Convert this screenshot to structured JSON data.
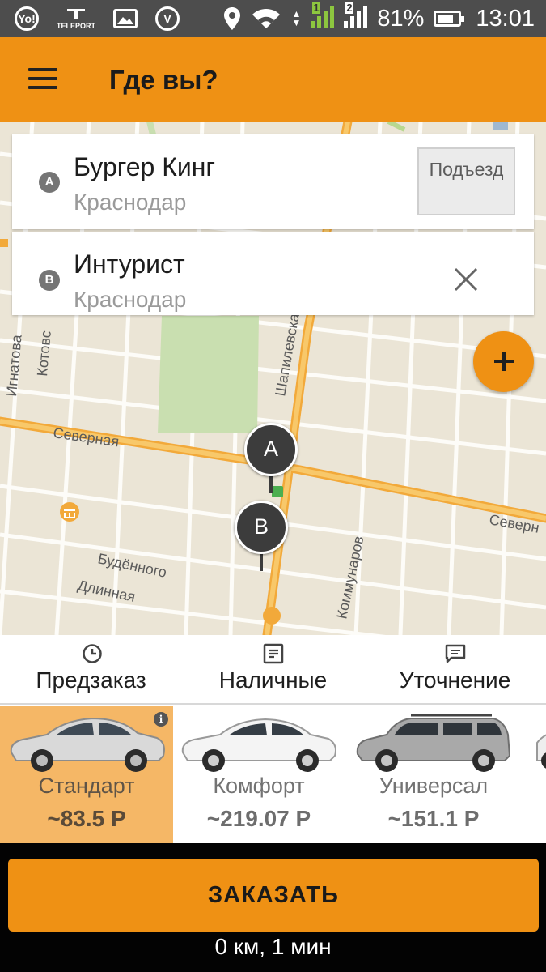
{
  "status_bar": {
    "teleport_label": "TELEPORT",
    "battery_percent": "81%",
    "battery_level": 0.81,
    "sim1": "1",
    "sim2": "2",
    "time": "13:01"
  },
  "app_bar": {
    "title": "Где вы?",
    "menu_icon": "hamburger-menu-icon"
  },
  "route": {
    "point_a": {
      "letter": "A",
      "name": "Бургер Кинг",
      "city": "Краснодар",
      "entrance_button": "Подъезд"
    },
    "point_b": {
      "letter": "B",
      "name": "Интурист",
      "city": "Краснодар",
      "clear_icon": "close-icon"
    }
  },
  "map": {
    "street_labels": {
      "severnaya": "Северная",
      "severnaya_right": "Северн",
      "shapilevskaya": "Шапилевская",
      "kotovskogo": "Котовс",
      "ignatova": "Игнатова",
      "budennogo": "Будённого",
      "dlinnaya": "Длинная",
      "kommunarov": "Коммунаров"
    },
    "pins": [
      "A",
      "B"
    ],
    "add_stop_icon": "plus-icon",
    "locate_icon": "navigation-arrow-icon"
  },
  "options": [
    {
      "label": "Предзаказ",
      "icon": "clock-icon"
    },
    {
      "label": "Наличные",
      "icon": "wallet-icon"
    },
    {
      "label": "Уточнение",
      "icon": "comment-icon"
    }
  ],
  "tariffs": [
    {
      "name": "Стандарт",
      "price": "~83.5 Р",
      "selected": true,
      "info_icon": "info-icon"
    },
    {
      "name": "Комфорт",
      "price": "~219.07 Р",
      "selected": false
    },
    {
      "name": "Универсал",
      "price": "~151.1 Р",
      "selected": false
    }
  ],
  "order": {
    "button_label": "ЗАКАЗАТЬ",
    "route_info": "0 км, 1 мин"
  },
  "colors": {
    "accent": "#ef9114",
    "selected_tariff_bg": "#f5b766",
    "status_bar_bg": "#4d4d4d",
    "bottom_bg": "#030303"
  }
}
